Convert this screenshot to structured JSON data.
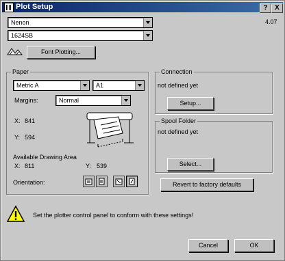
{
  "window": {
    "title": "Plot Setup",
    "help_label": "?",
    "close_label": "X"
  },
  "top": {
    "device": "Nenon",
    "model": "1624SB",
    "version": "4.07",
    "font_plotting_label": "Font Plotting..."
  },
  "paper": {
    "label": "Paper",
    "type": "Metric A",
    "size": "A1",
    "margins_label": "Margins:",
    "margins_value": "Normal",
    "x_label": "X:",
    "x_value": "841",
    "y_label": "Y:",
    "y_value": "594",
    "available_label": "Available Drawing Area",
    "ax_label": "X:",
    "ax_value": "811",
    "ay_label": "Y:",
    "ay_value": "539",
    "orientation_label": "Orientation:"
  },
  "connection": {
    "label": "Connection",
    "status": "not defined yet",
    "setup_label": "Setup..."
  },
  "spool": {
    "label": "Spool Folder",
    "status": "not defined yet",
    "select_label": "Select..."
  },
  "revert_label": "Revert to factory defaults",
  "warning_text": "Set the plotter control panel to conform with these settings!",
  "cancel_label": "Cancel",
  "ok_label": "OK",
  "icons": [
    "plotter-small-icon",
    "plotter-illustration-icon",
    "warning-icon",
    "orientation-icons"
  ]
}
